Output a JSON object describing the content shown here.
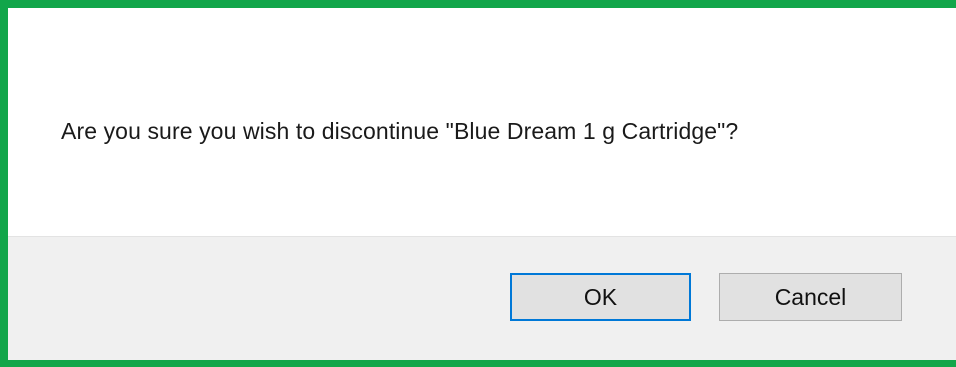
{
  "dialog": {
    "message": "Are you sure you wish to discontinue \"Blue Dream 1 g Cartridge\"?",
    "ok_label": "OK",
    "cancel_label": "Cancel"
  },
  "colors": {
    "highlight_border": "#12a64a",
    "focus_border": "#0078d7",
    "footer_background": "#f0f0f0",
    "button_background": "#e1e1e1"
  }
}
